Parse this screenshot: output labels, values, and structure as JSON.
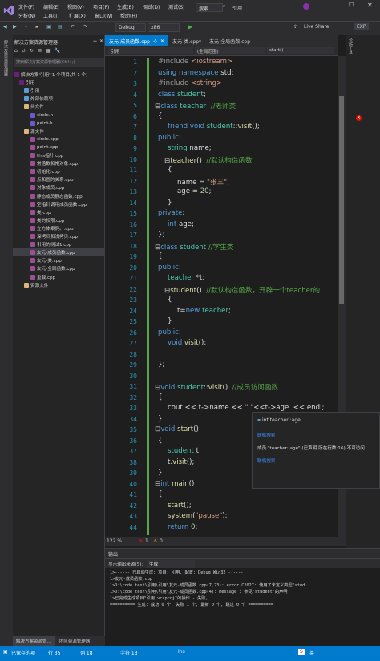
{
  "menu": {
    "file": "文件(F)",
    "edit": "编辑(E)",
    "view": "视图(V)",
    "project": "项目(P)",
    "build": "生成(B)",
    "debug": "调试(D)",
    "test": "测试(S)",
    "analyze": "分析(N)",
    "tools": "工具(T)",
    "extensions": "扩展(X)",
    "window": "窗口(W)",
    "help": "帮助(H)",
    "search_placeholder": "搜索...",
    "solution_name": "引用",
    "live_share": "Live Share",
    "exp": "EXP"
  },
  "toolbar": {
    "config": "Debug",
    "platform": "x86"
  },
  "left_strip": {
    "label1": "解决方案资源管理器",
    "label2": "团队资源管理器"
  },
  "right_strip": {
    "label": "诊断工具"
  },
  "solution_explorer": {
    "title": "解决方案资源管理器",
    "search_placeholder": "搜索解决方案资源管理器(Ctrl+;)",
    "items": [
      {
        "label": "解决方案'引用'(1 个项目/共 1 个)",
        "icon": "sln"
      },
      {
        "label": "引用",
        "icon": "proj"
      },
      {
        "label": "引用",
        "icon": "ref"
      },
      {
        "label": "外部依赖项",
        "icon": "ref"
      },
      {
        "label": "头文件",
        "icon": "folder"
      },
      {
        "label": "circle.h",
        "icon": "h"
      },
      {
        "label": "point.h",
        "icon": "h"
      },
      {
        "label": "源文件",
        "icon": "folder"
      },
      {
        "label": "circle.cpp",
        "icon": "cpp"
      },
      {
        "label": "point.cpp",
        "icon": "cpp"
      },
      {
        "label": "this指针.cpp",
        "icon": "cpp"
      },
      {
        "label": "常函数和常对象.cpp",
        "icon": "cpp"
      },
      {
        "label": "初始化.cpp",
        "icon": "cpp"
      },
      {
        "label": "点和圆的关系.cpp",
        "icon": "cpp"
      },
      {
        "label": "对象成员.cpp",
        "icon": "cpp"
      },
      {
        "label": "静态成员静态函数.cpp",
        "icon": "cpp"
      },
      {
        "label": "空指针调用成员函数.cpp",
        "icon": "cpp"
      },
      {
        "label": "类.cpp",
        "icon": "cpp"
      },
      {
        "label": "类的权限.cpp",
        "icon": "cpp"
      },
      {
        "label": "立方体案例。.cpp",
        "icon": "cpp"
      },
      {
        "label": "深拷贝和浅拷贝.cpp",
        "icon": "cpp"
      },
      {
        "label": "引用的测试1.cpp",
        "icon": "cpp"
      },
      {
        "label": "友元-成员函数.cpp",
        "icon": "cpp",
        "selected": true
      },
      {
        "label": "友元-类.cpp",
        "icon": "cpp"
      },
      {
        "label": "友元-全局函数.cpp",
        "icon": "cpp"
      },
      {
        "label": "重载.cpp",
        "icon": "cpp"
      },
      {
        "label": "资源文件",
        "icon": "folder"
      }
    ],
    "bottom_tabs": [
      "解决方案资源管...",
      "团队资源管理器"
    ]
  },
  "tabs": [
    {
      "label": "友元-成员函数.cpp",
      "active": true
    },
    {
      "label": "友元-类.cpp*",
      "active": false
    },
    {
      "label": "友元-全局函数.cpp",
      "active": false
    }
  ],
  "navbar": {
    "project": "引用",
    "scope": "(全局范围)",
    "member": "start()"
  },
  "editor": {
    "line_numbers": [
      "1",
      "2",
      "3",
      "4",
      "5",
      "6",
      "7",
      "8",
      "9",
      "10",
      "11",
      "12",
      "13",
      "14",
      "15",
      "16",
      "17",
      "18",
      "19",
      "20",
      "21",
      "22",
      "23",
      "24",
      "25",
      "26",
      "27",
      "28",
      "29",
      "30",
      "31",
      "32",
      "33",
      "34",
      "35",
      "36",
      "37",
      "38",
      "39",
      "40",
      "41",
      "42",
      "43",
      "44"
    ]
  },
  "tooltip": {
    "title": "int teacher::age",
    "link1": "联机搜索",
    "error": "成员 \"teacher::age\" (已声明 所在行数:16) 不可访问",
    "link2": "联机搜索"
  },
  "zoom": {
    "level": "122 %",
    "errors": "1",
    "warnings": "0"
  },
  "output": {
    "title": "输出",
    "source_label": "显示输出来源(S):",
    "source_value": "生成",
    "lines": [
      "1>------ 已启动生成: 项目: 引用, 配置: Debug Win32 ------",
      "1>友元-成员函数.cpp",
      "1>D:\\code test\\引用\\引用\\友元-成员函数.cpp(7,23): error C2027: 使用了未定义类型\"stud",
      "1>D:\\code test\\引用\\引用\\友元-成员函数.cpp(4): message : 参见\"student\"的声明",
      "1>已完成生成项目\"引用.vcxproj\"的操作 - 失败。",
      "========== 生成: 成功 0 个, 失败 1 个, 最新 0 个, 跳过 0 个 =========="
    ]
  },
  "statusbar": {
    "status": "已保存的项",
    "line": "行 35",
    "col": "列 18",
    "char": "字符 13",
    "mode": "Ins"
  }
}
